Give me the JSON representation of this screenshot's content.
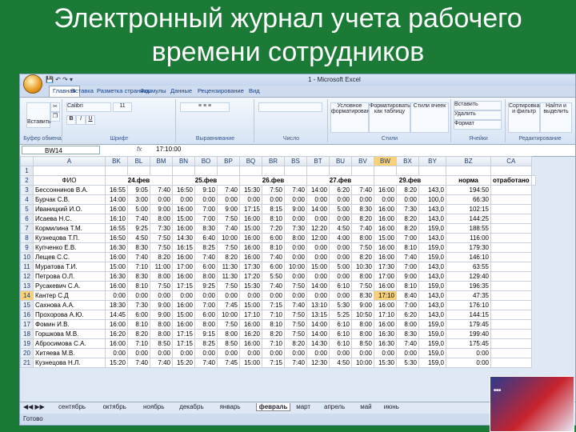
{
  "slide_title": "Электронный журнал учета рабочего времени сотрудников",
  "window_title": "1 - Microsoft Excel",
  "tabs": [
    "Главная",
    "Вставка",
    "Разметка страницы",
    "Формулы",
    "Данные",
    "Рецензирование",
    "Вид"
  ],
  "ribbon": {
    "paste": "Вставить",
    "font_name": "Calibri",
    "font_size": "11",
    "number_format": "",
    "cond_format": "Условное форматирование",
    "format_table": "Форматировать как таблицу",
    "cell_styles": "Стили ячеек",
    "insert": "Вставить",
    "delete": "Удалить",
    "format": "Формат",
    "sort": "Сортировка и фильтр",
    "find": "Найти и выделить",
    "groups": [
      "Буфер обмена",
      "Шрифт",
      "Выравнивание",
      "Число",
      "Стили",
      "Ячейки",
      "Редактирование"
    ]
  },
  "namebox": "BW14",
  "formula": "17:10:00",
  "fx": "fx",
  "columns": [
    "A",
    "BK",
    "BL",
    "BM",
    "BN",
    "BO",
    "BP",
    "BQ",
    "BR",
    "BS",
    "BT",
    "BU",
    "BV",
    "BW",
    "BX",
    "BY",
    "BZ",
    "CA"
  ],
  "header_row": {
    "fio": "ФИО",
    "dates": [
      "24.фев",
      "25.фев",
      "26.фев",
      "27.фев",
      "29.фев"
    ],
    "norm": "норма",
    "worked": "отработано"
  },
  "rows": [
    {
      "n": "3",
      "name": "Бессоннинов В.А.",
      "v": [
        "16:55",
        "9:05",
        "7:40",
        "16:50",
        "9:10",
        "7:40",
        "15:30",
        "7:50",
        "7:40",
        "14:00",
        "6:20",
        "7:40",
        "16:00",
        "8:20"
      ],
      "norm": "143,0",
      "worked": "194:50"
    },
    {
      "n": "4",
      "name": "Бурчак С.В.",
      "v": [
        "14:00",
        "3:00",
        "0:00",
        "0:00",
        "0:00",
        "0:00",
        "0:00",
        "0:00",
        "0:00",
        "0:00",
        "0:00",
        "0:00",
        "0:00",
        "0:00"
      ],
      "norm": "100,0",
      "worked": "66:30"
    },
    {
      "n": "5",
      "name": "Иваницкий И.О.",
      "v": [
        "16:00",
        "5:00",
        "9:00",
        "16:00",
        "7:00",
        "9:00",
        "17:15",
        "8:15",
        "9:00",
        "14:00",
        "5:00",
        "8:30",
        "16:00",
        "7:30"
      ],
      "norm": "143,0",
      "worked": "102:15"
    },
    {
      "n": "6",
      "name": "Исаева Н.С.",
      "v": [
        "16:10",
        "7:40",
        "8:00",
        "15:00",
        "7:00",
        "7:50",
        "16:00",
        "8:10",
        "0:00",
        "0:00",
        "0:00",
        "8:20",
        "16:00",
        "8:20"
      ],
      "norm": "143,0",
      "worked": "144:25"
    },
    {
      "n": "7",
      "name": "Кормилина Т.М.",
      "v": [
        "16:55",
        "9:25",
        "7:30",
        "16:00",
        "8:30",
        "7:40",
        "15:00",
        "7:20",
        "7:30",
        "12:20",
        "4:50",
        "7:40",
        "16:00",
        "8:20"
      ],
      "norm": "159,0",
      "worked": "188:55"
    },
    {
      "n": "8",
      "name": "Кузнецова Т.П.",
      "v": [
        "16:50",
        "4:50",
        "7:50",
        "14:30",
        "6:40",
        "10:00",
        "16:00",
        "6:00",
        "8:00",
        "12:00",
        "4:00",
        "8:00",
        "15:00",
        "7:00"
      ],
      "norm": "143,0",
      "worked": "116:00"
    },
    {
      "n": "9",
      "name": "Купченко Е.В.",
      "v": [
        "16:30",
        "8:30",
        "7:50",
        "16:15",
        "8:25",
        "7:50",
        "16:00",
        "8:10",
        "0:00",
        "0:00",
        "0:00",
        "7:50",
        "16:00",
        "8:10"
      ],
      "norm": "159,0",
      "worked": "179:30"
    },
    {
      "n": "10",
      "name": "Лещев С.С.",
      "v": [
        "16:00",
        "7:40",
        "8:20",
        "16:00",
        "7:40",
        "8:20",
        "16:00",
        "7:40",
        "0:00",
        "0:00",
        "0:00",
        "8:20",
        "16:00",
        "7:40"
      ],
      "norm": "159,0",
      "worked": "146:10"
    },
    {
      "n": "11",
      "name": "Муратова Т.И.",
      "v": [
        "15:00",
        "7:10",
        "11:00",
        "17:00",
        "6:00",
        "11:30",
        "17:30",
        "6:00",
        "10:00",
        "15:00",
        "5:00",
        "10:30",
        "17:30",
        "7:00"
      ],
      "norm": "143,0",
      "worked": "63:55"
    },
    {
      "n": "12",
      "name": "Петрова О.Л.",
      "v": [
        "16:30",
        "8:30",
        "8:00",
        "16:00",
        "8:00",
        "11:30",
        "17:20",
        "5:50",
        "0:00",
        "0:00",
        "0:00",
        "8:00",
        "17:00",
        "9:00"
      ],
      "norm": "143,0",
      "worked": "129:40"
    },
    {
      "n": "13",
      "name": "Русакевич С.А.",
      "v": [
        "16:00",
        "8:10",
        "7:50",
        "17:15",
        "9:25",
        "7:50",
        "15:30",
        "7:40",
        "7:50",
        "14:00",
        "6:10",
        "7:50",
        "16:00",
        "8:10"
      ],
      "norm": "159,0",
      "worked": "196:35"
    },
    {
      "n": "14",
      "name": "Кантер С.Д",
      "v": [
        "0:00",
        "0:00",
        "0:00",
        "0:00",
        "0:00",
        "0:00",
        "0:00",
        "0:00",
        "0:00",
        "0:00",
        "0:00",
        "8:30",
        "17:10",
        "8:40"
      ],
      "norm": "143,0",
      "worked": "47:35"
    },
    {
      "n": "15",
      "name": "Сахнова А.А.",
      "v": [
        "18:30",
        "7:30",
        "9:00",
        "16:00",
        "7:00",
        "7:45",
        "15:00",
        "7:15",
        "7:40",
        "13:10",
        "5:30",
        "9:00",
        "16:00",
        "7:00"
      ],
      "norm": "143,0",
      "worked": "176:10"
    },
    {
      "n": "16",
      "name": "Прохорова А.Ю.",
      "v": [
        "14:45",
        "6:00",
        "9:00",
        "15:00",
        "6:00",
        "10:00",
        "17:10",
        "7:10",
        "7:50",
        "13:15",
        "5:25",
        "10:50",
        "17:10",
        "6:20"
      ],
      "norm": "143,0",
      "worked": "144:15"
    },
    {
      "n": "17",
      "name": "Фомин И.В.",
      "v": [
        "16:00",
        "8:10",
        "8:00",
        "16:00",
        "8:00",
        "7:50",
        "16:00",
        "8:10",
        "7:50",
        "14:00",
        "6:10",
        "8:00",
        "16:00",
        "8:00"
      ],
      "norm": "159,0",
      "worked": "179:45"
    },
    {
      "n": "18",
      "name": "Горшкова М.В.",
      "v": [
        "16:20",
        "8:20",
        "8:00",
        "17:15",
        "9:15",
        "8:00",
        "16:20",
        "8:20",
        "7:50",
        "14:00",
        "6:10",
        "8:00",
        "16:30",
        "8:30"
      ],
      "norm": "159,0",
      "worked": "199:40"
    },
    {
      "n": "19",
      "name": "Абросимова С.А.",
      "v": [
        "16:00",
        "7:10",
        "8:50",
        "17:15",
        "8:25",
        "8:50",
        "16:00",
        "7:10",
        "8:20",
        "14:30",
        "6:10",
        "8:50",
        "16:30",
        "7:40"
      ],
      "norm": "159,0",
      "worked": "175:45"
    },
    {
      "n": "20",
      "name": "Хитяева М.В.",
      "v": [
        "0:00",
        "0:00",
        "0:00",
        "0:00",
        "0:00",
        "0:00",
        "0:00",
        "0:00",
        "0:00",
        "0:00",
        "0:00",
        "0:00",
        "0:00",
        "0:00"
      ],
      "norm": "159,0",
      "worked": "0:00"
    },
    {
      "n": "21",
      "name": "Кузнецова Н.Л.",
      "v": [
        "15:20",
        "7:40",
        "7:40",
        "15:20",
        "7:40",
        "7:45",
        "15:00",
        "7:15",
        "7:40",
        "12:30",
        "4:50",
        "10:00",
        "15:30",
        "5:30"
      ],
      "norm": "159,0",
      "worked": "0:00"
    }
  ],
  "sheet_tabs": [
    "сентябрь",
    "октябрь",
    "ноябрь",
    "декабрь",
    "январь",
    "февраль",
    "март",
    "апрель",
    "май",
    "июнь"
  ],
  "active_sheet": "февраль",
  "status": "Готово",
  "colors": {
    "background": "#1a7a36",
    "selected_cell": "#f8d27a",
    "header_bg": "#dfe6f0"
  }
}
